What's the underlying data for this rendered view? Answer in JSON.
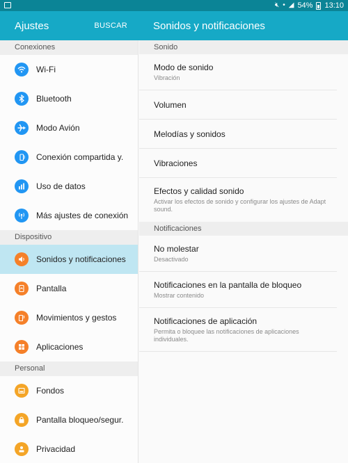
{
  "status_bar": {
    "battery": "54%",
    "time": "13:10"
  },
  "left_header": {
    "title": "Ajustes",
    "search_label": "BUSCAR"
  },
  "right_header": {
    "title": "Sonidos y notificaciones"
  },
  "sidebar": {
    "sections": [
      {
        "title": "Conexiones",
        "items": [
          {
            "label": "Wi-Fi",
            "icon": "wifi-icon"
          },
          {
            "label": "Bluetooth",
            "icon": "bluetooth-icon"
          },
          {
            "label": "Modo Avión",
            "icon": "airplane-icon"
          },
          {
            "label": "Conexión compartida y.",
            "icon": "tethering-icon"
          },
          {
            "label": "Uso de datos",
            "icon": "data-usage-icon"
          },
          {
            "label": "Más ajustes de conexión",
            "icon": "more-connections-icon"
          }
        ]
      },
      {
        "title": "Dispositivo",
        "items": [
          {
            "label": "Sonidos y notificaciones",
            "icon": "speaker-icon",
            "selected": true
          },
          {
            "label": "Pantalla",
            "icon": "display-icon"
          },
          {
            "label": "Movimientos y gestos",
            "icon": "motion-icon"
          },
          {
            "label": "Aplicaciones",
            "icon": "apps-icon"
          }
        ]
      },
      {
        "title": "Personal",
        "items": [
          {
            "label": "Fondos",
            "icon": "wallpaper-icon"
          },
          {
            "label": "Pantalla bloqueo/segur.",
            "icon": "lock-icon"
          },
          {
            "label": "Privacidad",
            "icon": "privacy-icon"
          }
        ]
      }
    ]
  },
  "main": {
    "sections": [
      {
        "title": "Sonido",
        "items": [
          {
            "title": "Modo de sonido",
            "subtitle": "Vibración"
          },
          {
            "title": "Volumen",
            "subtitle": ""
          },
          {
            "title": "Melodías y sonidos",
            "subtitle": ""
          },
          {
            "title": "Vibraciones",
            "subtitle": ""
          },
          {
            "title": "Efectos y calidad sonido",
            "subtitle": "Activar los efectos de sonido y configurar los ajustes de Adapt sound."
          }
        ]
      },
      {
        "title": "Notificaciones",
        "items": [
          {
            "title": "No molestar",
            "subtitle": "Desactivado"
          },
          {
            "title": "Notificaciones en la pantalla de bloqueo",
            "subtitle": "Mostrar contenido"
          },
          {
            "title": "Notificaciones de aplicación",
            "subtitle": "Permita o bloquee las notificaciones de aplicaciones individuales."
          }
        ]
      }
    ]
  },
  "colors": {
    "accent": "#16a9c6",
    "status_bar": "#0b8496",
    "selected": "#bfe6f2",
    "icon_blue": "#2196f3",
    "icon_orange": "#f58029",
    "icon_amber": "#f4a527"
  }
}
